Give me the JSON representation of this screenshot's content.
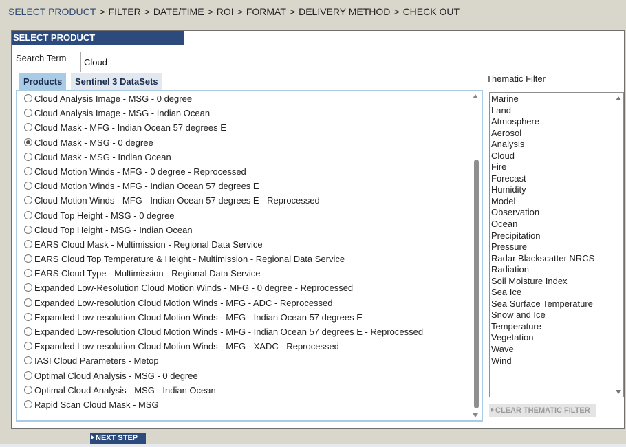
{
  "breadcrumb": {
    "steps": [
      "SELECT PRODUCT",
      "FILTER",
      "DATE/TIME",
      "ROI",
      "FORMAT",
      "DELIVERY METHOD",
      "CHECK OUT"
    ],
    "separator": ">"
  },
  "panel": {
    "title": "SELECT PRODUCT"
  },
  "search": {
    "label": "Search Term",
    "value": "Cloud"
  },
  "tabs": [
    "Products",
    "Sentinel 3 DataSets"
  ],
  "products": [
    "Cloud Analysis Image - MSG - 0 degree",
    "Cloud Analysis Image - MSG - Indian Ocean",
    "Cloud Mask - MFG - Indian Ocean 57 degrees E",
    "Cloud Mask - MSG - 0 degree",
    "Cloud Mask - MSG - Indian Ocean",
    "Cloud Motion Winds - MFG - 0 degree - Reprocessed",
    "Cloud Motion Winds - MFG - Indian Ocean 57 degrees E",
    "Cloud Motion Winds - MFG - Indian Ocean 57 degrees E - Reprocessed",
    "Cloud Top Height - MSG - 0 degree",
    "Cloud Top Height - MSG - Indian Ocean",
    "EARS Cloud Mask - Multimission - Regional Data Service",
    "EARS Cloud Top Temperature & Height - Multimission - Regional Data Service",
    "EARS Cloud Type - Multimission - Regional Data Service",
    "Expanded Low-Resolution Cloud Motion Winds - MFG - 0 degree - Reprocessed",
    "Expanded Low-resolution Cloud Motion Winds - MFG - ADC - Reprocessed",
    "Expanded Low-resolution Cloud Motion Winds - MFG - Indian Ocean 57 degrees E",
    "Expanded Low-resolution Cloud Motion Winds - MFG - Indian Ocean 57 degrees E - Reprocessed",
    "Expanded Low-resolution Cloud Motion Winds - MFG - XADC - Reprocessed",
    "IASI Cloud Parameters - Metop",
    "Optimal Cloud Analysis - MSG - 0 degree",
    "Optimal Cloud Analysis - MSG - Indian Ocean",
    "Rapid Scan Cloud Mask - MSG"
  ],
  "selected_product": "Cloud Mask - MSG - 0 degree",
  "thematic": {
    "title": "Thematic Filter",
    "items": [
      "Marine",
      "Land",
      "Atmosphere",
      "Aerosol",
      "Analysis",
      "Cloud",
      "Fire",
      "Forecast",
      "Humidity",
      "Model",
      "Observation",
      "Ocean",
      "Precipitation",
      "Pressure",
      "Radar Blackscatter NRCS",
      "Radiation",
      "Soil Moisture Index",
      "Sea Ice",
      "Sea Surface Temperature",
      "Snow and Ice",
      "Temperature",
      "Vegetation",
      "Wave",
      "Wind"
    ],
    "clear_label": "CLEAR THEMATIC FILTER"
  },
  "next_label": "NEXT STEP"
}
